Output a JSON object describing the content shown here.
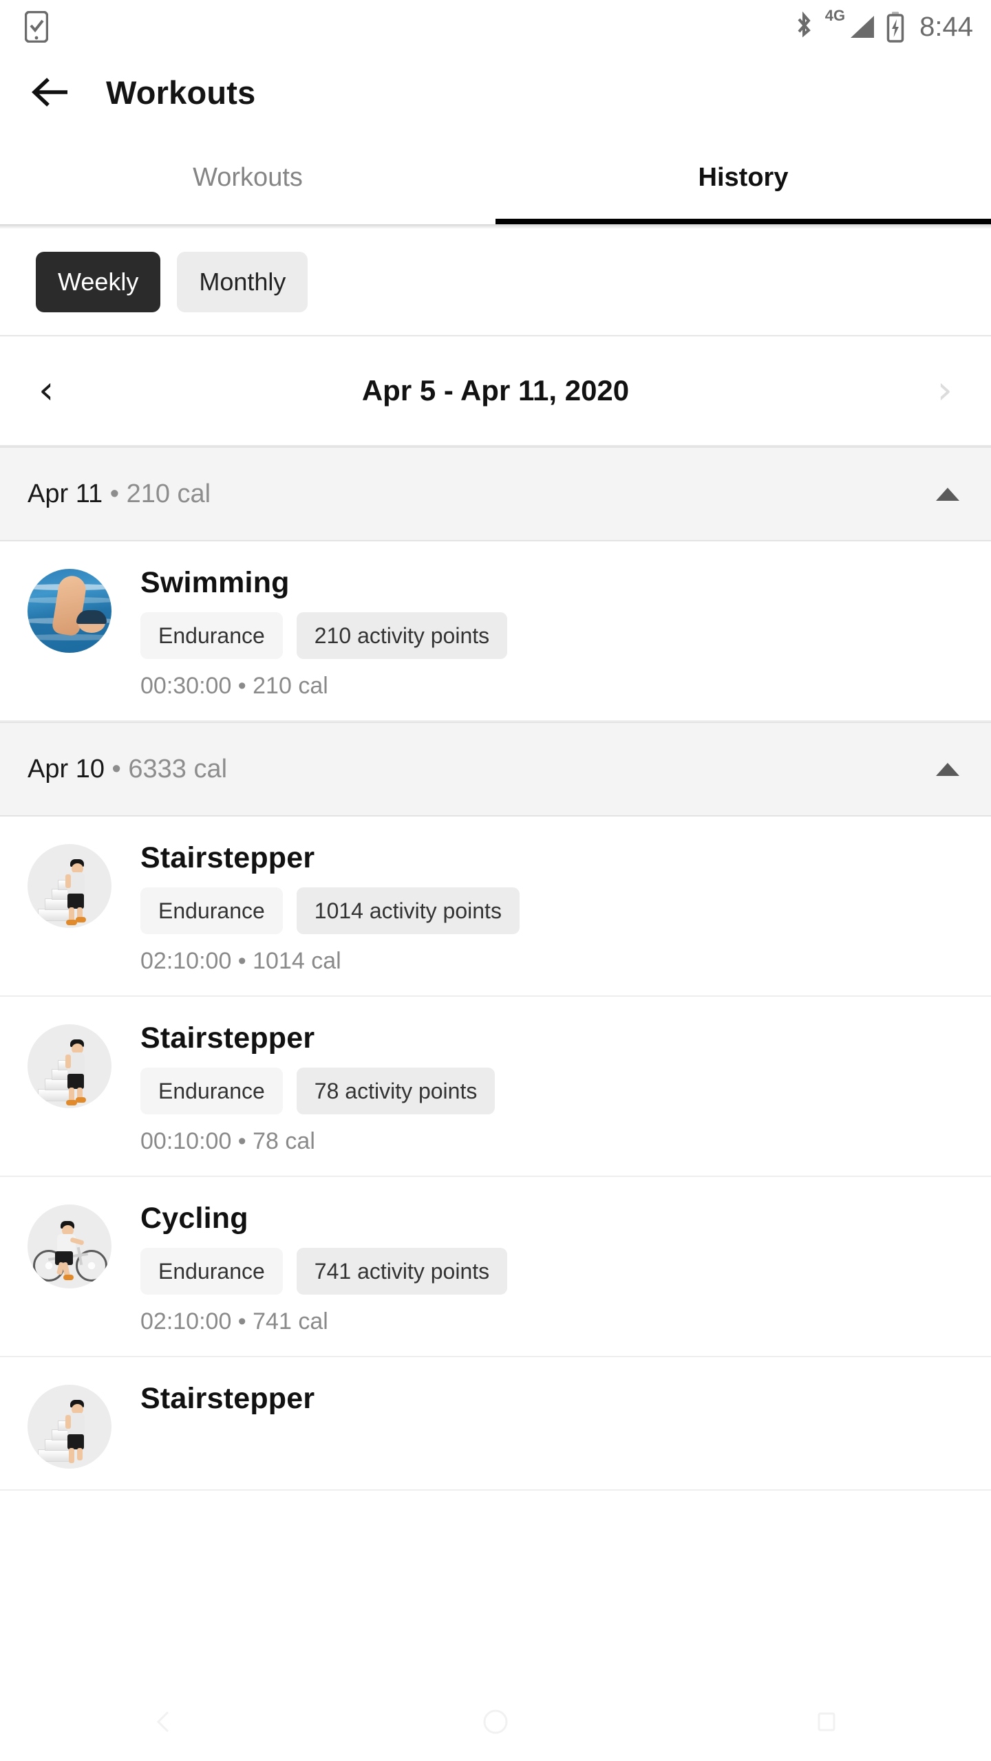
{
  "status_bar": {
    "left_icon": "phone-check-icon",
    "bluetooth_icon": "bluetooth-icon",
    "network_label": "4G",
    "signal_icon": "signal-bars-icon",
    "battery_icon": "battery-charging-icon",
    "time": "8:44"
  },
  "app_bar": {
    "back_icon": "back-arrow-icon",
    "title": "Workouts"
  },
  "tabs": [
    {
      "label": "Workouts",
      "active": false
    },
    {
      "label": "History",
      "active": true
    }
  ],
  "segments": [
    {
      "label": "Weekly",
      "selected": true
    },
    {
      "label": "Monthly",
      "selected": false
    }
  ],
  "date_nav": {
    "prev_icon": "chevron-left-icon",
    "next_icon": "chevron-right-icon",
    "range": "Apr 5 - Apr 11, 2020",
    "prev_enabled": true,
    "next_enabled": false
  },
  "days": [
    {
      "date": "Apr 11",
      "separator": "•",
      "calories": "210 cal",
      "collapse_icon": "caret-up-icon",
      "workouts": [
        {
          "avatar": "swimming-photo",
          "title": "Swimming",
          "type_chip": "Endurance",
          "points_chip": "210 activity points",
          "meta": "00:30:00 • 210 cal"
        }
      ]
    },
    {
      "date": "Apr 10",
      "separator": "•",
      "calories": "6333 cal",
      "collapse_icon": "caret-up-icon",
      "workouts": [
        {
          "avatar": "stairstepper-photo",
          "title": "Stairstepper",
          "type_chip": "Endurance",
          "points_chip": "1014 activity points",
          "meta": "02:10:00 • 1014 cal"
        },
        {
          "avatar": "stairstepper-photo",
          "title": "Stairstepper",
          "type_chip": "Endurance",
          "points_chip": "78 activity points",
          "meta": "00:10:00 • 78 cal"
        },
        {
          "avatar": "cycling-photo",
          "title": "Cycling",
          "type_chip": "Endurance",
          "points_chip": "741 activity points",
          "meta": "02:10:00 • 741 cal"
        },
        {
          "avatar": "stairstepper-photo",
          "title": "Stairstepper",
          "type_chip": "",
          "points_chip": "",
          "meta": ""
        }
      ]
    }
  ],
  "nav_bar": {
    "back_icon": "nav-back-icon",
    "home_icon": "nav-home-icon",
    "recents_icon": "nav-recents-icon"
  },
  "colors": {
    "accent_dark": "#2b2b2b",
    "chip_light": "#f5f5f5",
    "chip_gray": "#ececec",
    "section_bg": "#f4f4f4",
    "muted_text": "#8a8a8a"
  }
}
